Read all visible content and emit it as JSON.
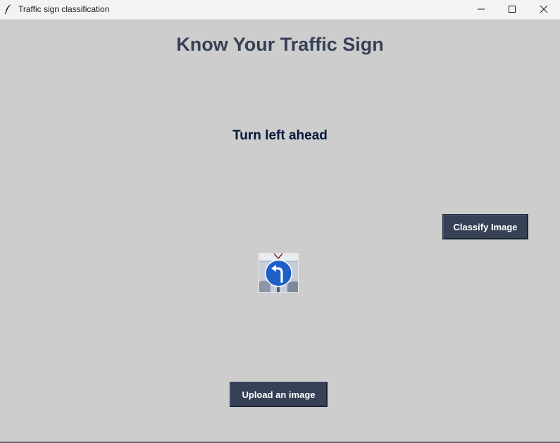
{
  "window": {
    "title": "Traffic sign classification",
    "icon": "feather-icon",
    "controls": [
      "minimize-icon",
      "maximize-icon",
      "close-icon"
    ]
  },
  "main": {
    "heading": "Know Your Traffic Sign",
    "result": "Turn left ahead",
    "classify_label": "Classify Image",
    "upload_label": "Upload an image",
    "image_icon": "turn-left-sign-icon"
  },
  "colors": {
    "background": "#cdcdcd",
    "heading": "#364156",
    "result": "#011638",
    "button_bg": "#364156",
    "button_text": "#ffffff",
    "sign_blue": "#1f5fc8"
  }
}
